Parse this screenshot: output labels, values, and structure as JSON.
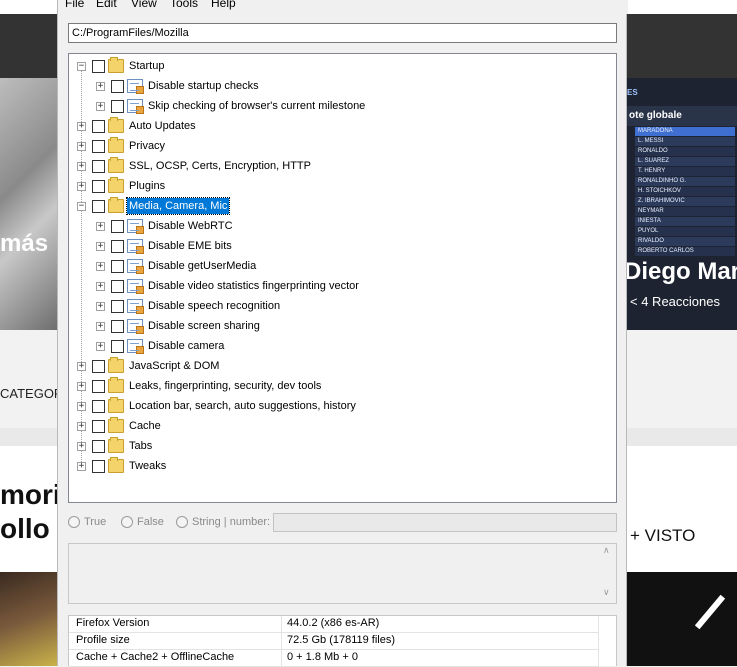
{
  "background": {
    "left_headline": "más",
    "right_headline": "Diego Mar",
    "reactions": "4 Reacciones",
    "categories_label": "CATEGOR",
    "bottom_headline": [
      "mori",
      "ollo"
    ],
    "visto_label": "+ VISTO",
    "rating_logo": "ES",
    "rating_header": "ote globale",
    "rating_rows": [
      "MARADONA",
      "L. MESSI",
      "RONALDO",
      "L. SUAREZ",
      "T. HENRY",
      "RONALDINHO G.",
      "H. STOICHKOV",
      "Z. IBRAHIMOVIC",
      "NEYMAR",
      "INIESTA",
      "PUYOL",
      "RIVALDO",
      "ROBERTO CARLOS"
    ]
  },
  "menu": [
    "File",
    "Edit",
    "View",
    "Tools",
    "Help"
  ],
  "path_value": "C:/ProgramFiles/Mozilla",
  "tree": [
    {
      "label": "Startup",
      "type": "folder",
      "expanded": true,
      "level": 0
    },
    {
      "label": "Disable startup checks",
      "type": "doc",
      "level": 1
    },
    {
      "label": "Skip checking of browser's current milestone",
      "type": "doc",
      "level": 1
    },
    {
      "label": "Auto Updates",
      "type": "folder",
      "level": 0
    },
    {
      "label": "Privacy",
      "type": "folder",
      "level": 0
    },
    {
      "label": "SSL, OCSP, Certs, Encryption, HTTP",
      "type": "folder",
      "level": 0
    },
    {
      "label": "Plugins",
      "type": "folder",
      "level": 0
    },
    {
      "label": "Media, Camera, Mic",
      "type": "folder",
      "expanded": true,
      "selected": true,
      "level": 0
    },
    {
      "label": "Disable WebRTC",
      "type": "doc",
      "level": 1
    },
    {
      "label": "Disable EME bits",
      "type": "doc",
      "level": 1
    },
    {
      "label": "Disable getUserMedia",
      "type": "doc",
      "level": 1
    },
    {
      "label": "Disable video statistics fingerprinting vector",
      "type": "doc",
      "level": 1
    },
    {
      "label": "Disable speech recognition",
      "type": "doc",
      "level": 1
    },
    {
      "label": "Disable screen sharing",
      "type": "doc",
      "level": 1
    },
    {
      "label": "Disable camera",
      "type": "doc",
      "level": 1
    },
    {
      "label": "JavaScript & DOM",
      "type": "folder",
      "level": 0
    },
    {
      "label": "Leaks, fingerprinting, security, dev tools",
      "type": "folder",
      "level": 0
    },
    {
      "label": "Location bar, search, auto suggestions, history",
      "type": "folder",
      "level": 0
    },
    {
      "label": "Cache",
      "type": "folder",
      "level": 0
    },
    {
      "label": "Tabs",
      "type": "folder",
      "level": 0
    },
    {
      "label": "Tweaks",
      "type": "folder",
      "level": 0
    }
  ],
  "radios": {
    "true_label": "True",
    "false_label": "False",
    "string_label": "String | number:"
  },
  "info": [
    {
      "key": "Firefox Version",
      "value": "44.0.2 (x86 es-AR)"
    },
    {
      "key": "Profile size",
      "value": "72.5 Gb (178119 files)"
    },
    {
      "key": "Cache + Cache2 + OfflineCache",
      "value": "0 + 1.8 Mb + 0"
    }
  ],
  "colors": {
    "selection": "#0078d7",
    "folder": "#f5d36b"
  }
}
